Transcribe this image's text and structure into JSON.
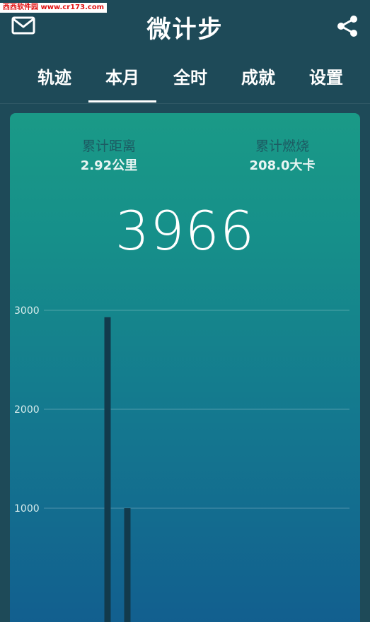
{
  "watermark": "西西软件园 www.cr173.com",
  "header": {
    "title": "微计步",
    "mail_icon": "mail-icon",
    "share_icon": "share-icon"
  },
  "tabs": [
    {
      "label": "轨迹",
      "active": false
    },
    {
      "label": "本月",
      "active": true
    },
    {
      "label": "全时",
      "active": false
    },
    {
      "label": "成就",
      "active": false
    },
    {
      "label": "设置",
      "active": false
    }
  ],
  "summary": {
    "distance_label": "累计距离",
    "distance_value": "2.92公里",
    "calories_label": "累计燃烧",
    "calories_value": "208.0大卡",
    "total_steps": "3966"
  },
  "chart_data": {
    "type": "bar",
    "title": "",
    "xlabel": "",
    "ylabel": "",
    "y_ticks": [
      1000,
      2000,
      3000
    ],
    "y_tick_labels": [
      "1000",
      "2000",
      "3000"
    ],
    "grid": true,
    "x_range": [
      1,
      31
    ],
    "bars": [
      {
        "x": 9,
        "value": 2930
      },
      {
        "x": 10,
        "value": 1000
      }
    ],
    "bar_color": "#123a4c"
  },
  "colors": {
    "background": "#1e4a58",
    "card_top": "#1a9a87",
    "card_bottom": "#125f8f",
    "label_text": "#1c5b63"
  }
}
